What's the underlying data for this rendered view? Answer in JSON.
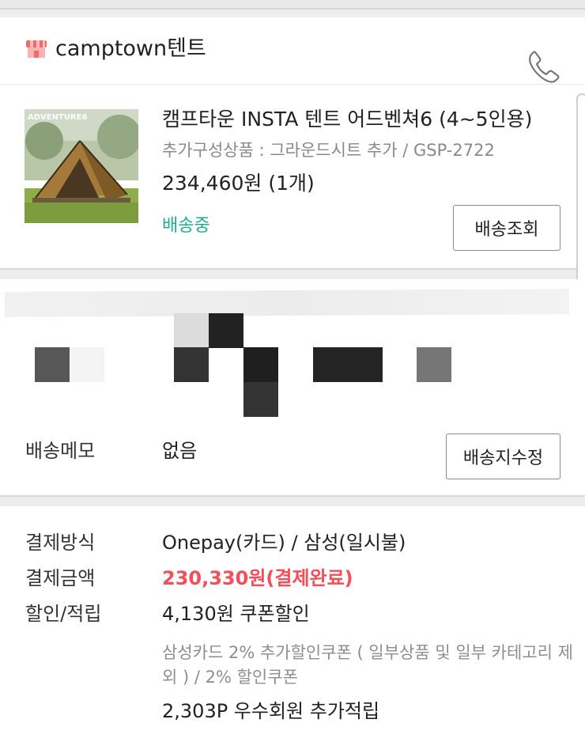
{
  "seller": {
    "store_icon": "store-awning-icon",
    "name": "camptown텐트",
    "phone_icon": "phone-icon",
    "icon_color": "#f26a6a"
  },
  "product": {
    "title": "캠프타운 INSTA 텐트 어드벤쳐6 (4~5인용)",
    "option": "추가구성상품 : 그라운드시트 추가 / GSP-2722",
    "price": "234,460원 (1개)",
    "status": "배송중",
    "status_color": "#1fae8d",
    "track_button": "배송조회",
    "thumbnail_text": "ADVENTURE6"
  },
  "address": {
    "memo_label": "배송메모",
    "memo_value": "없음",
    "edit_button": "배송지수정"
  },
  "payment": {
    "method_label": "결제방식",
    "method_value": "Onepay(카드) / 삼성(일시불)",
    "amount_label": "결제금액",
    "amount_value": "230,330원(결제완료)",
    "amount_color": "#f0505a",
    "discount_label": "할인/적립",
    "discount_value": "4,130원 쿠폰할인",
    "discount_note": "삼성카드 2% 추가할인쿠폰 ( 일부상품 및 일부 카테고리 제외 ) / 2% 할인쿠폰",
    "points_value": "2,303P 우수회원 추가적립"
  }
}
